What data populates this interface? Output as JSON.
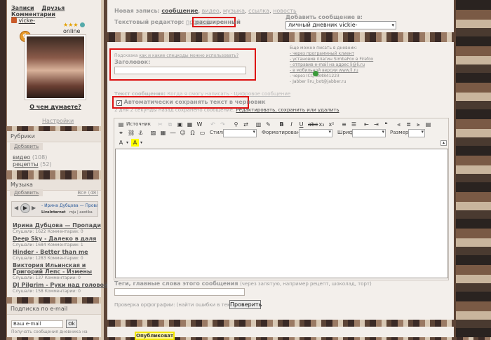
{
  "topnav": {
    "notes": "Записи",
    "friends": "Друзья",
    "comments": "Комментарии"
  },
  "user": {
    "name": "vicke-",
    "status": "online",
    "stars": "★★★",
    "think_link": "О чем думаете?",
    "settings_link": "Настройки"
  },
  "rubrics": {
    "title": "Рубрики",
    "add": "Добавить",
    "items": [
      {
        "name": "видео",
        "count": "(108)"
      },
      {
        "name": "рецепты",
        "count": "(52)"
      }
    ]
  },
  "music": {
    "title": "Музыка",
    "add": "Добавить",
    "all": "Все (48)",
    "player": {
      "track": "- Ирина Дубцова — Прова",
      "brand": "LiveInternet",
      "author": "mju | aeotika"
    },
    "tracks": [
      {
        "title": "Ирина Дубцова — Пропади",
        "meta": "Слушали: 1622 Комментарии: 0"
      },
      {
        "title": "Deep Sky - Далеко в даля",
        "meta": "Слушали: 1684 Комментарии: 1"
      },
      {
        "title": "Hinder - Better than me",
        "meta": "Слушали: 1283 Комментарии: 0"
      },
      {
        "title": "Виктория Ильинская и Григорий Лепс - Измены",
        "meta": "Слушали: 137 Комментарии: 0"
      },
      {
        "title": "DJ Pilgrim - Руки над головой",
        "meta": "Слушали: 158 Комментарии: 0"
      }
    ]
  },
  "subscribe": {
    "title": "Подписка по e-mail",
    "placeholder": "Ваш e-mail",
    "ok": "Ok",
    "desc": "Получать сообщения дневника на"
  },
  "new_post": {
    "label": "Новая запись:",
    "types": [
      "сообщение",
      "видео",
      "музыка",
      "ссылка",
      "новость"
    ],
    "editor_label": "Текстовый редактор:",
    "editor_simple": "простой",
    "editor_advanced": "расширенный",
    "add_to_label": "Добавить сообщение в:",
    "add_to_value": "личный дневник vickie-"
  },
  "title_block": {
    "hint_prefix": "Подсказка",
    "hint_link": "как и какие спецкоды можно использовать?",
    "label": "Заголовок:"
  },
  "ways": {
    "title": "Еще можно писать в дневник:",
    "items": [
      "- через программный клиент",
      "- установив плагин SimbaFox в Firefox",
      "- отправив e-mail на адрес li@li.ru",
      "- в мобильной версии www.li.ru",
      "- через ICQ      484841223",
      "- Jabber liru_bot@jabber.ru"
    ]
  },
  "message": {
    "label": "Текст сообщения:",
    "link1": "Когда я смогу написать",
    "link2": "Цифровое сообщение",
    "autosave": "Автоматически сохранять текст в черновик",
    "draft_note": "2 дня 2 секунды назад сохранено сообщение.",
    "restore": "Редактировать, сохранить или удалить"
  },
  "toolbar": {
    "source": "Источник",
    "style": "Стиль",
    "format": "Форматирование",
    "font": "Шрифт",
    "size": "Размер"
  },
  "tags": {
    "label": "Теги, главные слова этого сообщения",
    "hint": "(через запятую, например рецепт, шоколад, торт)"
  },
  "spell": {
    "label": "Проверка орфографии: (найти ошибки в тексте)",
    "button": "Проверить"
  },
  "publish": {
    "button": "Опубликовать"
  }
}
